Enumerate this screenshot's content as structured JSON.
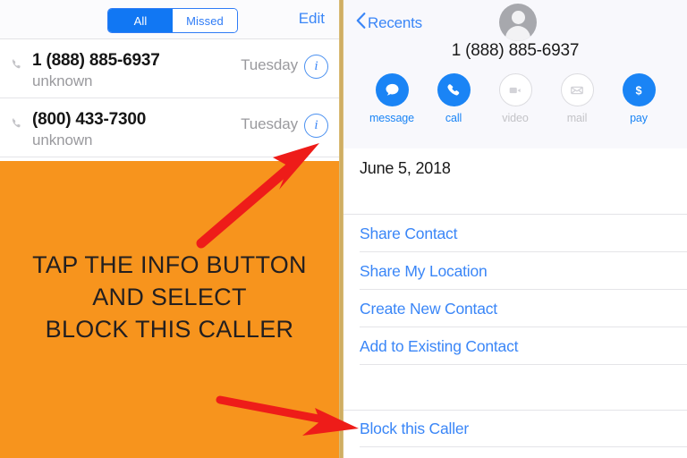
{
  "left_panel": {
    "header": {
      "segmented": {
        "options": [
          {
            "label": "All",
            "selected": true
          },
          {
            "label": "Missed",
            "selected": false
          }
        ],
        "all_label": "All",
        "missed_label": "Missed"
      },
      "edit_label": "Edit"
    },
    "calls": [
      {
        "number": "1 (888) 885-6937",
        "subtitle": "unknown",
        "when": "Tuesday",
        "info_glyph": "i",
        "call_icon": "outgoing-call-icon"
      },
      {
        "number": "(800) 433-7300",
        "subtitle": "unknown",
        "when": "Tuesday",
        "info_glyph": "i",
        "call_icon": "outgoing-call-icon"
      }
    ],
    "callout": {
      "line1": "TAP THE INFO BUTTON",
      "line2": "AND SELECT",
      "line3": "BLOCK THIS CALLER",
      "background_color": "#f7941d",
      "text_color": "#231f20"
    },
    "annotations": {
      "arrow_color": "#ee1c19",
      "arrow_top_target": "info-button-row-2",
      "arrow_bottom_target": "block-this-caller-item"
    }
  },
  "right_panel": {
    "back_label": "Recents",
    "avatar": "default-contact-avatar",
    "contact_number": "1 (888) 885-6937",
    "actions": [
      {
        "label": "message",
        "icon": "message-bubble-icon",
        "enabled": true
      },
      {
        "label": "call",
        "icon": "phone-icon",
        "enabled": true
      },
      {
        "label": "video",
        "icon": "video-camera-icon",
        "enabled": false
      },
      {
        "label": "mail",
        "icon": "envelope-icon",
        "enabled": false
      },
      {
        "label": "pay",
        "icon": "dollar-sign-icon",
        "enabled": true
      }
    ],
    "date_label": "June 5, 2018",
    "menu_items": [
      {
        "label": "Share Contact"
      },
      {
        "label": "Share My Location"
      },
      {
        "label": "Create New Contact"
      },
      {
        "label": "Add to Existing Contact"
      }
    ],
    "block_item": {
      "label": "Block this Caller"
    },
    "accent_color": "#3a86f7"
  }
}
